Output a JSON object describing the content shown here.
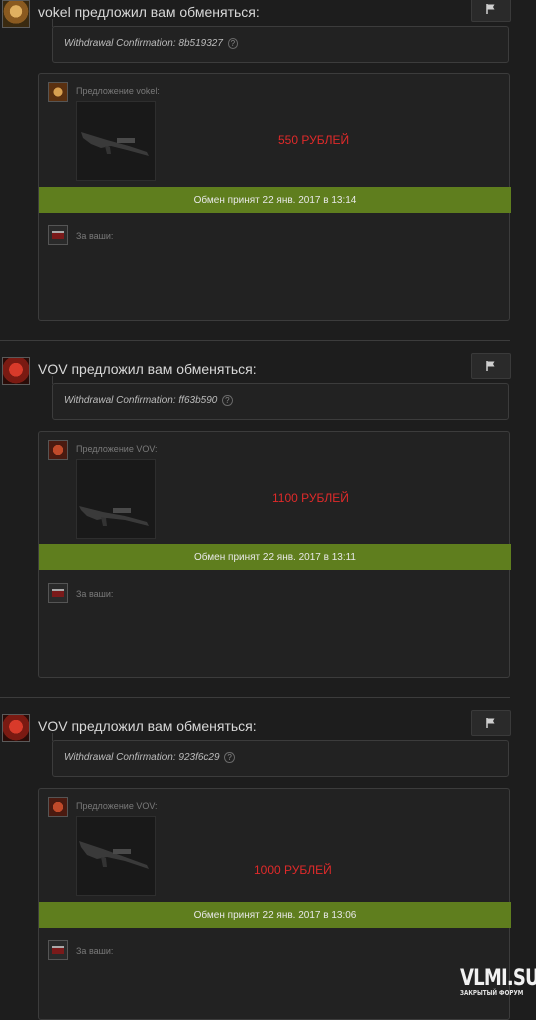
{
  "offers": [
    {
      "title": "vokel предложил вам обменяться:",
      "message": "Withdrawal Confirmation: 8b519327",
      "help": "?",
      "offer_label": "Предложение vokel:",
      "price": "550 РУБЛЕЙ",
      "status": "Обмен принят 22 янв. 2017 в 13:14",
      "your_label": "За ваши:"
    },
    {
      "title": "VOV предложил вам обменяться:",
      "message": "Withdrawal Confirmation: ff63b590",
      "help": "?",
      "offer_label": "Предложение VOV:",
      "price": "1100 РУБЛЕЙ",
      "status": "Обмен принят 22 янв. 2017 в 13:11",
      "your_label": "За ваши:"
    },
    {
      "title": "VOV предложил вам обменяться:",
      "message": "Withdrawal Confirmation: 923f6c29",
      "help": "?",
      "offer_label": "Предложение VOV:",
      "price": "1000 РУБЛЕЙ",
      "status": "Обмен принят 22 янв. 2017 в 13:06",
      "your_label": "За ваши:"
    }
  ],
  "watermark": {
    "main": "VLMI.SU",
    "sub": "ЗАКРЫТЫЙ ФОРУМ"
  },
  "colors": {
    "status_bg": "#5f7e1e",
    "price": "#e02a2a",
    "panel_bg": "#222222"
  }
}
